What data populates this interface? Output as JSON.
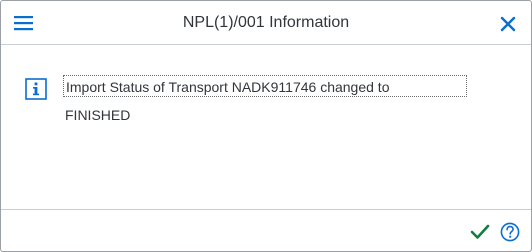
{
  "dialog": {
    "title": "NPL(1)/001 Information",
    "menu_icon": "hamburger-menu-icon",
    "close_icon": "close-icon"
  },
  "message": {
    "icon": "info-icon",
    "line1": "Import Status of Transport NADK911746 changed to",
    "line2": "FINISHED"
  },
  "footer": {
    "ok_icon": "checkmark-icon",
    "help_icon": "help-icon"
  },
  "colors": {
    "accent": "#0a6ed1",
    "ok_green": "#107e3e",
    "text": "#32363a"
  }
}
